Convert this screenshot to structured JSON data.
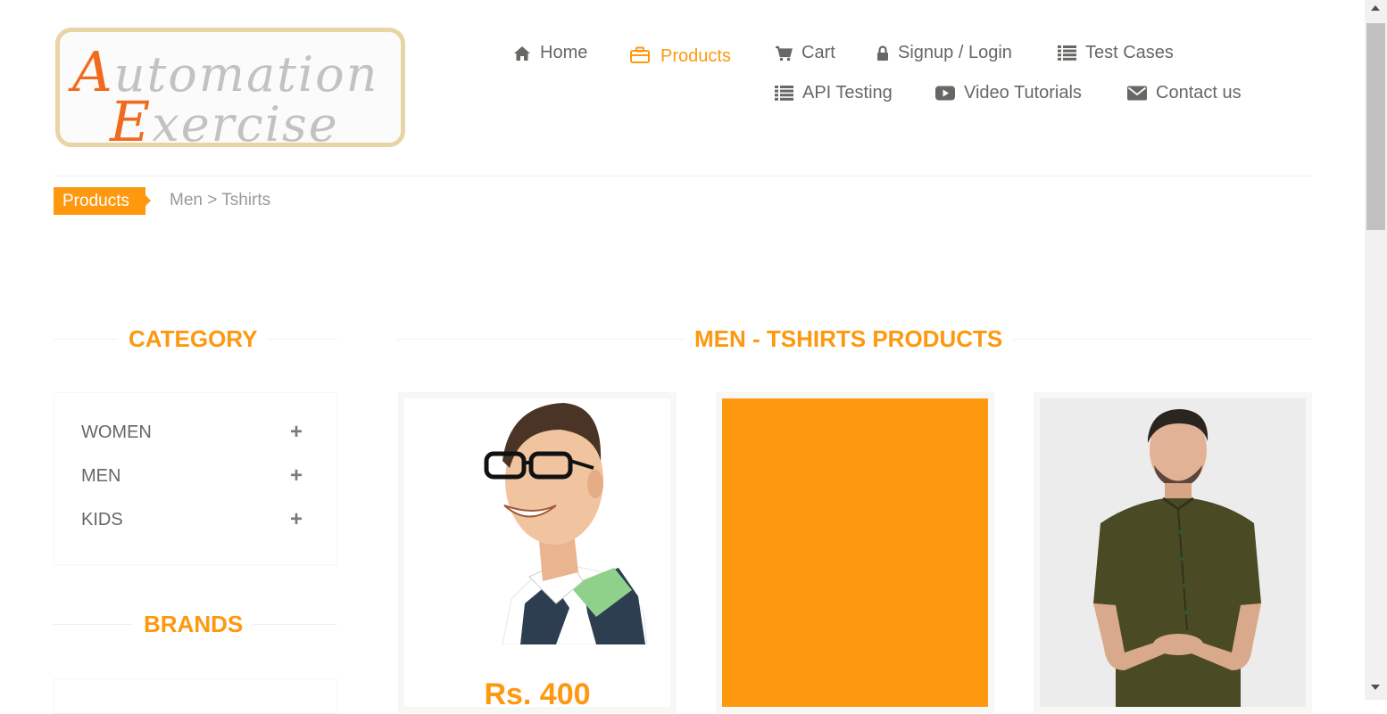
{
  "logo": {
    "line1_cap": "A",
    "line1_rest": "utomation",
    "line2_cap": "E",
    "line2_rest": "xercise"
  },
  "nav": [
    {
      "label": "Home",
      "icon": "home-icon"
    },
    {
      "label": "Products",
      "icon": "briefcase-icon",
      "active": true
    },
    {
      "label": "Cart",
      "icon": "cart-icon"
    },
    {
      "label": "Signup / Login",
      "icon": "lock-icon"
    },
    {
      "label": "Test Cases",
      "icon": "list-icon"
    },
    {
      "label": "API Testing",
      "icon": "list-icon"
    },
    {
      "label": "Video Tutorials",
      "icon": "youtube-play-icon"
    },
    {
      "label": "Contact us",
      "icon": "envelope-icon"
    }
  ],
  "breadcrumb": {
    "active": "Products",
    "rest": "Men > Tshirts"
  },
  "sidebar": {
    "category_title": "CATEGORY",
    "categories": [
      {
        "label": "WOMEN",
        "toggle": "+"
      },
      {
        "label": "MEN",
        "toggle": "+"
      },
      {
        "label": "KIDS",
        "toggle": "+"
      }
    ],
    "brands_title": "BRANDS"
  },
  "main": {
    "title": "MEN - TSHIRTS PRODUCTS",
    "products": [
      {
        "price": "Rs. 400",
        "image": "man-glasses-polo-photo"
      },
      {
        "price": "",
        "image": "orange-placeholder",
        "color": "#fe980f"
      },
      {
        "price": "",
        "image": "man-olive-shirt-photo"
      }
    ]
  },
  "colors": {
    "accent": "#fe980f",
    "text": "#696763"
  }
}
